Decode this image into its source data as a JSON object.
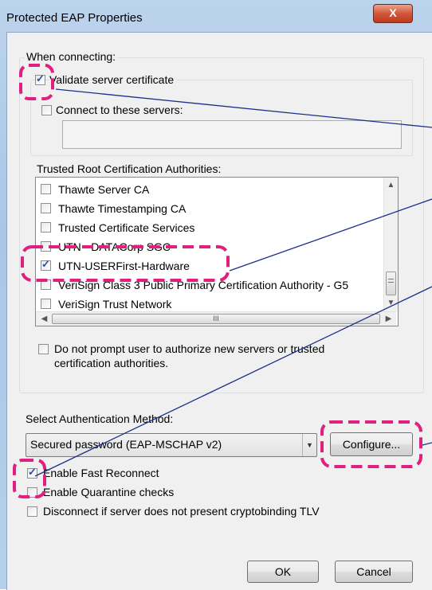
{
  "window": {
    "title": "Protected EAP Properties",
    "close_label": "X"
  },
  "connecting": {
    "heading": "When connecting:",
    "validate_label": "Validate server certificate",
    "validate_checked": true,
    "connect_servers_label": "Connect to these servers:",
    "connect_servers_checked": false,
    "servers_value": ""
  },
  "trusted": {
    "heading": "Trusted Root Certification Authorities:",
    "items": [
      {
        "label": "Thawte Server CA",
        "checked": false
      },
      {
        "label": "Thawte Timestamping CA",
        "checked": false
      },
      {
        "label": "Trusted Certificate Services",
        "checked": false
      },
      {
        "label": "UTN - DATACorp SGC",
        "checked": false
      },
      {
        "label": "UTN-USERFirst-Hardware",
        "checked": true
      },
      {
        "label": "VeriSign Class 3 Public Primary Certification Authority - G5",
        "checked": false
      },
      {
        "label": "VeriSign Trust Network",
        "checked": false
      }
    ],
    "scroll_grip": "III"
  },
  "prompt": {
    "label_line1": "Do not prompt user to authorize new servers or trusted",
    "label_line2": "certification authorities.",
    "checked": false
  },
  "auth": {
    "heading": "Select Authentication Method:",
    "method_value": "Secured password (EAP-MSCHAP v2)",
    "configure_label": "Configure..."
  },
  "options": {
    "fast_reconnect_label": "Enable Fast Reconnect",
    "fast_reconnect_checked": true,
    "quarantine_label": "Enable Quarantine checks",
    "quarantine_checked": false,
    "cryptobinding_label": "Disconnect if server does not present cryptobinding TLV",
    "cryptobinding_checked": false
  },
  "buttons": {
    "ok_label": "OK",
    "cancel_label": "Cancel"
  },
  "colors": {
    "highlight_dash": "#e0207f",
    "callout_line": "#1a2f8a"
  }
}
